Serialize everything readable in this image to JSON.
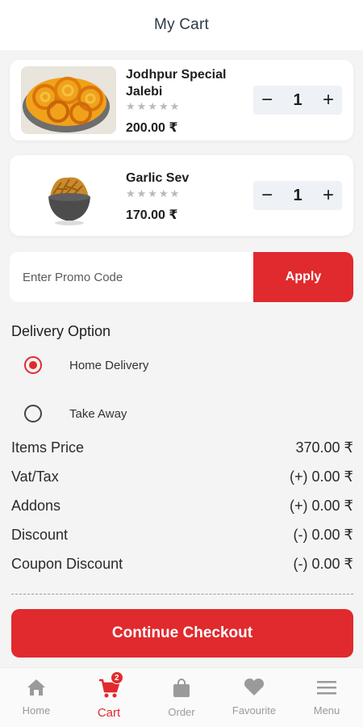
{
  "header": {
    "title": "My Cart"
  },
  "cart_items": [
    {
      "name": "Jodhpur Special Jalebi",
      "rating_stars": "★★★★★",
      "price": "200.00 ₹",
      "qty": "1",
      "minus": "−",
      "plus": "+"
    },
    {
      "name": "Garlic Sev",
      "rating_stars": "★★★★★",
      "price": "170.00 ₹",
      "qty": "1",
      "minus": "−",
      "plus": "+"
    }
  ],
  "promo": {
    "placeholder": "Enter Promo Code",
    "apply_label": "Apply"
  },
  "delivery": {
    "title": "Delivery Option",
    "options": [
      {
        "label": "Home Delivery",
        "selected": true
      },
      {
        "label": "Take Away",
        "selected": false
      }
    ]
  },
  "summary": [
    {
      "label": "Items Price",
      "value": "370.00 ₹"
    },
    {
      "label": "Vat/Tax",
      "value": "(+) 0.00 ₹"
    },
    {
      "label": "Addons",
      "value": "(+) 0.00 ₹"
    },
    {
      "label": "Discount",
      "value": "(-) 0.00 ₹"
    },
    {
      "label": "Coupon Discount",
      "value": "(-) 0.00 ₹"
    }
  ],
  "checkout": {
    "label": "Continue Checkout"
  },
  "bottom_nav": {
    "items": [
      {
        "label": "Home",
        "icon": "home-icon"
      },
      {
        "label": "Cart",
        "icon": "cart-icon",
        "badge": "2",
        "active": true
      },
      {
        "label": "Order",
        "icon": "bag-icon"
      },
      {
        "label": "Favourite",
        "icon": "heart-icon"
      },
      {
        "label": "Menu",
        "icon": "menu-icon"
      }
    ]
  },
  "colors": {
    "accent": "#e02a2e",
    "text": "#1f1f1f",
    "background": "#f4f4f4",
    "qty_bg": "#eef2f6"
  }
}
